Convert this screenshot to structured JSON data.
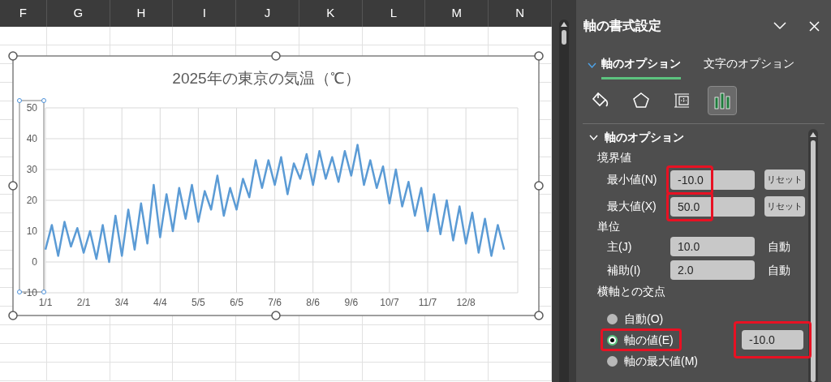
{
  "sheet": {
    "columns": [
      "F",
      "G",
      "H",
      "I",
      "J",
      "K",
      "L",
      "M",
      "N"
    ]
  },
  "chart": {
    "chart_data": {
      "type": "line",
      "title": "2025年の東京の気温（℃）",
      "categories": [
        "1/1",
        null,
        null,
        null,
        null,
        null,
        "2/1",
        null,
        null,
        null,
        null,
        null,
        "3/4",
        null,
        null,
        null,
        null,
        null,
        "4/4",
        null,
        null,
        null,
        null,
        null,
        "5/5",
        null,
        null,
        null,
        null,
        null,
        "6/5",
        null,
        null,
        null,
        null,
        null,
        "7/6",
        null,
        null,
        null,
        null,
        null,
        "8/6",
        null,
        null,
        null,
        null,
        null,
        "9/6",
        null,
        null,
        null,
        null,
        null,
        "10/7",
        null,
        null,
        null,
        null,
        null,
        "11/7",
        null,
        null,
        null,
        null,
        null,
        "12/8",
        null,
        null,
        null,
        null,
        null,
        null
      ],
      "series": [
        {
          "color": "#5b9bd5",
          "values": [
            4,
            12,
            2,
            13,
            5,
            11,
            3,
            10,
            1,
            12,
            0,
            15,
            2,
            17,
            4,
            19,
            6,
            25,
            8,
            22,
            10,
            24,
            14,
            25,
            13,
            23,
            17,
            28,
            15,
            24,
            17,
            27,
            21,
            33,
            24,
            33,
            25,
            34,
            22,
            32,
            27,
            35,
            25,
            36,
            27,
            34,
            26,
            36,
            28,
            38,
            25,
            33,
            24,
            31,
            19,
            30,
            18,
            26,
            15,
            24,
            10,
            22,
            9,
            20,
            7,
            18,
            6,
            16,
            3,
            14,
            2,
            12,
            4
          ]
        }
      ],
      "grid": true,
      "ylim": [
        -10,
        50
      ],
      "yticks": [
        -10,
        0,
        10,
        20,
        30,
        40,
        50
      ]
    }
  },
  "panel": {
    "title": "軸の書式設定",
    "tabs": [
      {
        "label": "軸のオプション",
        "selected": true
      },
      {
        "label": "文字のオプション",
        "selected": false
      }
    ],
    "icon_tabs": [
      {
        "kind": "fill",
        "selected": false
      },
      {
        "kind": "effects",
        "selected": false
      },
      {
        "kind": "size",
        "selected": false
      },
      {
        "kind": "axis",
        "selected": true
      }
    ],
    "section": {
      "title": "軸のオプション",
      "expanded": true
    },
    "bounds": {
      "heading": "境界値",
      "rows": [
        {
          "label": "最小値(N)",
          "value": "-10.0",
          "button": "リセット",
          "highlighted": true
        },
        {
          "label": "最大値(X)",
          "value": "50.0",
          "button": "リセット",
          "highlighted": true
        }
      ]
    },
    "units": {
      "heading": "単位",
      "rows": [
        {
          "label": "主(J)",
          "value": "10.0",
          "status": "自動"
        },
        {
          "label": "補助(I)",
          "value": "2.0",
          "status": "自動"
        }
      ]
    },
    "crosses": {
      "heading": "横軸との交点",
      "options": [
        {
          "label": "自動(O)",
          "selected": false,
          "highlighted": false
        },
        {
          "label": "軸の値(E)",
          "selected": true,
          "highlighted": true,
          "value": "-10.0"
        },
        {
          "label": "軸の最大値(M)",
          "selected": false,
          "highlighted": false
        }
      ]
    }
  }
}
